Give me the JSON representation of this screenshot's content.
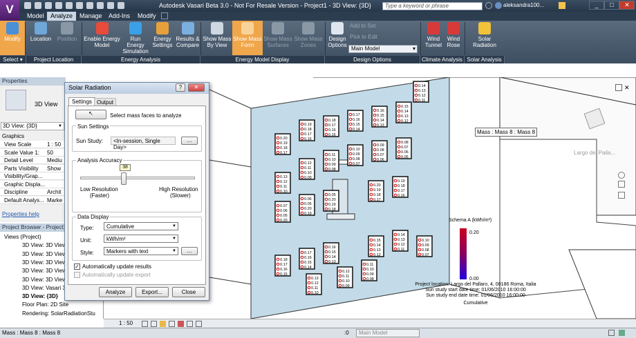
{
  "app": {
    "title": "Autodesk Vasari Beta 3.0 - Not For Resale Version -  Project1 - 3D View: {3D}",
    "logo": "V",
    "search_placeholder": "Type a keyword or phrase",
    "user": "aleksandra100..."
  },
  "menu_tabs": [
    "Model",
    "Analyze",
    "Manage",
    "Add-Ins",
    "Modify"
  ],
  "active_tab": "Analyze",
  "ribbon": {
    "buttons": [
      {
        "label1": "Modify",
        "label2": "",
        "icon": "cursor-icon",
        "color": "#4a90d9"
      },
      {
        "label1": "Location",
        "label2": "",
        "icon": "globe-icon",
        "color": "#6fa7d9"
      },
      {
        "label1": "Position",
        "label2": "",
        "icon": "position-icon",
        "color": "#8a97a5"
      },
      {
        "label1": "Enable Energy",
        "label2": "Model",
        "icon": "energy-model-icon",
        "color": "#e84b3a"
      },
      {
        "label1": "Run Energy",
        "label2": "Simulation",
        "icon": "run-simulation-icon",
        "color": "#3aa0e8"
      },
      {
        "label1": "Energy",
        "label2": "Settings",
        "icon": "energy-settings-icon",
        "color": "#e8a13a"
      },
      {
        "label1": "Results &",
        "label2": "Compare",
        "icon": "results-icon",
        "color": "#7ab0e0"
      },
      {
        "label1": "Show Mass",
        "label2": "By View",
        "icon": "mass-view-icon",
        "color": "#cfd8e2"
      },
      {
        "label1": "Show Mass",
        "label2": "Form",
        "icon": "mass-form-icon",
        "color": "#f7d39a"
      },
      {
        "label1": "Show Mass",
        "label2": "Surfaces",
        "icon": "mass-surfaces-icon",
        "color": "#8a97a5"
      },
      {
        "label1": "Show Mass",
        "label2": "Zones",
        "icon": "mass-zones-icon",
        "color": "#8a97a5"
      },
      {
        "label1": "Design",
        "label2": "Options",
        "icon": "design-options-icon",
        "color": "#dfe6ee"
      },
      {
        "label1": "Wind",
        "label2": "Tunnel",
        "icon": "wind-tunnel-icon",
        "color": "#d83a3a"
      },
      {
        "label1": "Wind",
        "label2": "Rose",
        "icon": "wind-rose-icon",
        "color": "#d83a3a"
      },
      {
        "label1": "Solar",
        "label2": "Radiation",
        "icon": "solar-radiation-icon",
        "color": "#f2c23a"
      }
    ],
    "add_to_set": "Add to Set",
    "pick_to_edit": "Pick to Edit",
    "main_model": "Main Model",
    "groups": [
      "Select ▾",
      "Project Location",
      "Energy Analysis",
      "Energy Model Display",
      "Design Options",
      "Climate Analysis",
      "Solar Analysis"
    ]
  },
  "properties": {
    "header": "Properties",
    "type": "3D View",
    "view_select": "3D View: {3D}",
    "edit_type": "Edit Type",
    "section": "Graphics",
    "rows": [
      {
        "name": "View Scale",
        "value": "1 : 50"
      },
      {
        "name": "Scale Value  1:",
        "value": "50"
      },
      {
        "name": "Detail Level",
        "value": "Mediu"
      },
      {
        "name": "Parts Visibility",
        "value": "Show"
      },
      {
        "name": "Visibility/Grap...",
        "value": ""
      },
      {
        "name": "Graphic Displa...",
        "value": ""
      },
      {
        "name": "Discipline",
        "value": "Archit"
      },
      {
        "name": "Default Analys...",
        "value": "Marke"
      }
    ],
    "help": "Properties help"
  },
  "browser": {
    "header": "Project Browser - Project1",
    "items": [
      "Views (Project)",
      "3D View: 3D View",
      "3D View: 3D View",
      "3D View: 3D View",
      "3D View: 3D View",
      "3D View: 3D View",
      "3D View: Vasari 3",
      "3D View: {3D}",
      "Floor Plan: 2D Site",
      "Rendering: SolarRadiationStu"
    ]
  },
  "dialog": {
    "title": "Solar Radiation",
    "tabs": [
      "Settings",
      "Output"
    ],
    "select_faces": "Select mass faces to analyze",
    "sun_settings_label": "Sun Settings",
    "sun_study_label": "Sun Study:",
    "sun_study_value": "<In-session, Single Day>",
    "browse": "...",
    "accuracy_label": "Analysis Accuracy",
    "accuracy_value": "38",
    "accuracy_fraction": 0.38,
    "low_res": "Low  Resolution",
    "faster": "(Faster)",
    "high_res": "High Resolution",
    "slower": "(Slower)",
    "data_display_label": "Data Display",
    "type_label": "Type:",
    "type_value": "Cumulative",
    "unit_label": "Unit:",
    "unit_value": "kWh/m²",
    "style_label": "Style:",
    "style_value": "Markers with text",
    "auto_update": "Automatically update results",
    "auto_export": "Automatically update export",
    "analyze": "Analyze",
    "export": "Export...",
    "close": "Close"
  },
  "viewport": {
    "tooltip": "Mass : Mass 8 : Mass 8",
    "viewcube_label": "Largo del Paila...",
    "legend_title": "Schema A (kWh/m²)",
    "legend_max": "0.20",
    "legend_min": "0.00",
    "info": [
      "Project location: Largo del Pallaro, 4, 00186 Roma, Italia",
      "Sun study start date time: 01/06/2010 16:00:00",
      "Sun study end date time: 01/06/2010 16:00:00",
      "Cumulative"
    ],
    "marker_values": [
      "0.20",
      "0.19",
      "0.18",
      "0.17",
      "0.16",
      "0.15",
      "0.14",
      "0.13",
      "0.12",
      "0.11",
      "0.10",
      "0.09",
      "0.08",
      "0.07",
      "0.06",
      "0.05"
    ]
  },
  "view_bar": {
    "scale": "1 : 50"
  },
  "status": {
    "text": "Mass : Mass 8 : Mass 8",
    "model": "Main Model",
    "count": ":0"
  },
  "colors": {
    "accent": "#f0a64a",
    "marker": "#cc0000",
    "facade": "#c3dbe8"
  }
}
